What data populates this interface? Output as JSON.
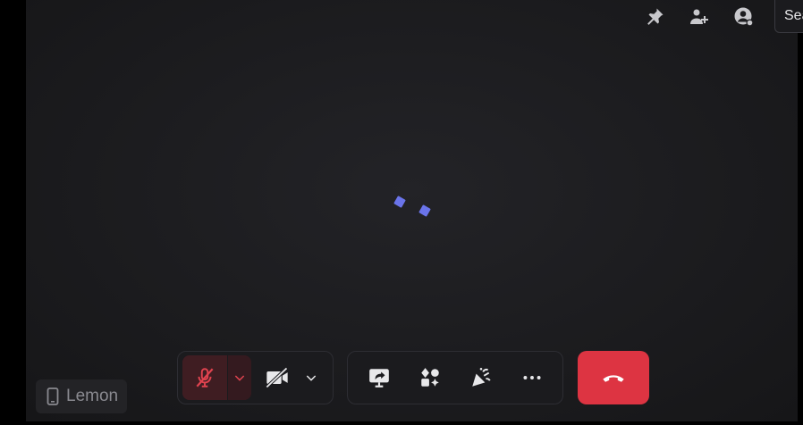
{
  "header": {
    "icons": [
      "pin-icon",
      "add-people-icon",
      "account-status-icon"
    ],
    "search_text": "Sea"
  },
  "call": {
    "loading_icon": "loading-spinner-icon",
    "controls": {
      "mic": {
        "icon": "mic-muted-icon",
        "state": "muted"
      },
      "camera": {
        "icon": "camera-off-icon",
        "state": "off"
      },
      "actions": [
        "share-screen-icon",
        "apps-icon",
        "reactions-icon",
        "more-icon"
      ],
      "leave_icon": "hang-up-icon"
    },
    "participant": {
      "name": "Lemon",
      "device_icon": "phone-icon"
    }
  },
  "colors": {
    "accent": "#6a74ea",
    "danger": "#dd3442",
    "mic_muted": "#e0434f"
  }
}
